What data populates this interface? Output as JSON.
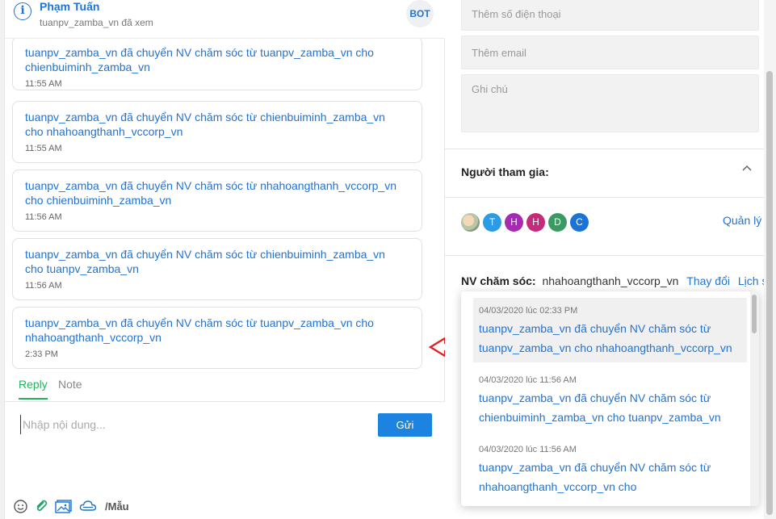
{
  "header": {
    "contact_name": "Phạm Tuấn",
    "seen_status": "tuanpv_zamba_vn đã xem",
    "bot_badge": "BOT",
    "info_icon": "i"
  },
  "messages": [
    {
      "text": "tuanpv_zamba_vn đã chuyển NV chăm sóc từ tuanpv_zamba_vn cho chienbuiminh_zamba_vn",
      "time": "11:55 AM"
    },
    {
      "text": "tuanpv_zamba_vn đã chuyển NV chăm sóc từ chienbuiminh_zamba_vn cho nhahoangthanh_vccorp_vn",
      "time": "11:55 AM"
    },
    {
      "text": "tuanpv_zamba_vn đã chuyển NV chăm sóc từ nhahoangthanh_vccorp_vn cho chienbuiminh_zamba_vn",
      "time": "11:56 AM"
    },
    {
      "text": "tuanpv_zamba_vn đã chuyển NV chăm sóc từ chienbuiminh_zamba_vn cho tuanpv_zamba_vn",
      "time": "11:56 AM"
    },
    {
      "text": "tuanpv_zamba_vn đã chuyển NV chăm sóc từ tuanpv_zamba_vn cho nhahoangthanh_vccorp_vn",
      "time": "2:33 PM"
    }
  ],
  "tabs": {
    "reply": "Reply",
    "note": "Note"
  },
  "composer": {
    "placeholder": "Nhập nội dung...",
    "send_label": "Gửi",
    "template_label": "/Mẫu"
  },
  "sidebar": {
    "phone_placeholder": "Thêm số điện thoại",
    "email_placeholder": "Thêm email",
    "note_placeholder": "Ghi chú",
    "participants_title": "Người tham gia:",
    "participants": [
      {
        "initial": "",
        "color": "#b9c4a8",
        "kind": "photo"
      },
      {
        "initial": "T",
        "color": "#2b9be6"
      },
      {
        "initial": "H",
        "color": "#a62bb3"
      },
      {
        "initial": "H",
        "color": "#c42b7a"
      },
      {
        "initial": "D",
        "color": "#3b9a62"
      },
      {
        "initial": "C",
        "color": "#1a73d6"
      }
    ],
    "manage_label": "Quản lý",
    "agent_label": "NV chăm sóc:",
    "agent_name": "nhahoangthanh_vccorp_vn",
    "change_label": "Thay đổi",
    "history_label": "Lịch sử"
  },
  "history": [
    {
      "date": "04/03/2020 lúc 02:33 PM",
      "line1": "tuanpv_zamba_vn đã chuyển NV chăm sóc từ",
      "line2": "tuanpv_zamba_vn cho nhahoangthanh_vccorp_vn"
    },
    {
      "date": "04/03/2020 lúc 11:56 AM",
      "line1": "tuanpv_zamba_vn đã chuyển NV chăm sóc từ",
      "line2": "chienbuiminh_zamba_vn cho tuanpv_zamba_vn"
    },
    {
      "date": "04/03/2020 lúc 11:56 AM",
      "line1": "tuanpv_zamba_vn đã chuyển NV chăm sóc từ",
      "line2": "nhahoangthanh_vccorp_vn cho"
    }
  ],
  "colors": {
    "accent": "#2173d4",
    "reply_tab": "#25b05f",
    "send_button": "#1c84e0",
    "arrow": "#e02020"
  }
}
